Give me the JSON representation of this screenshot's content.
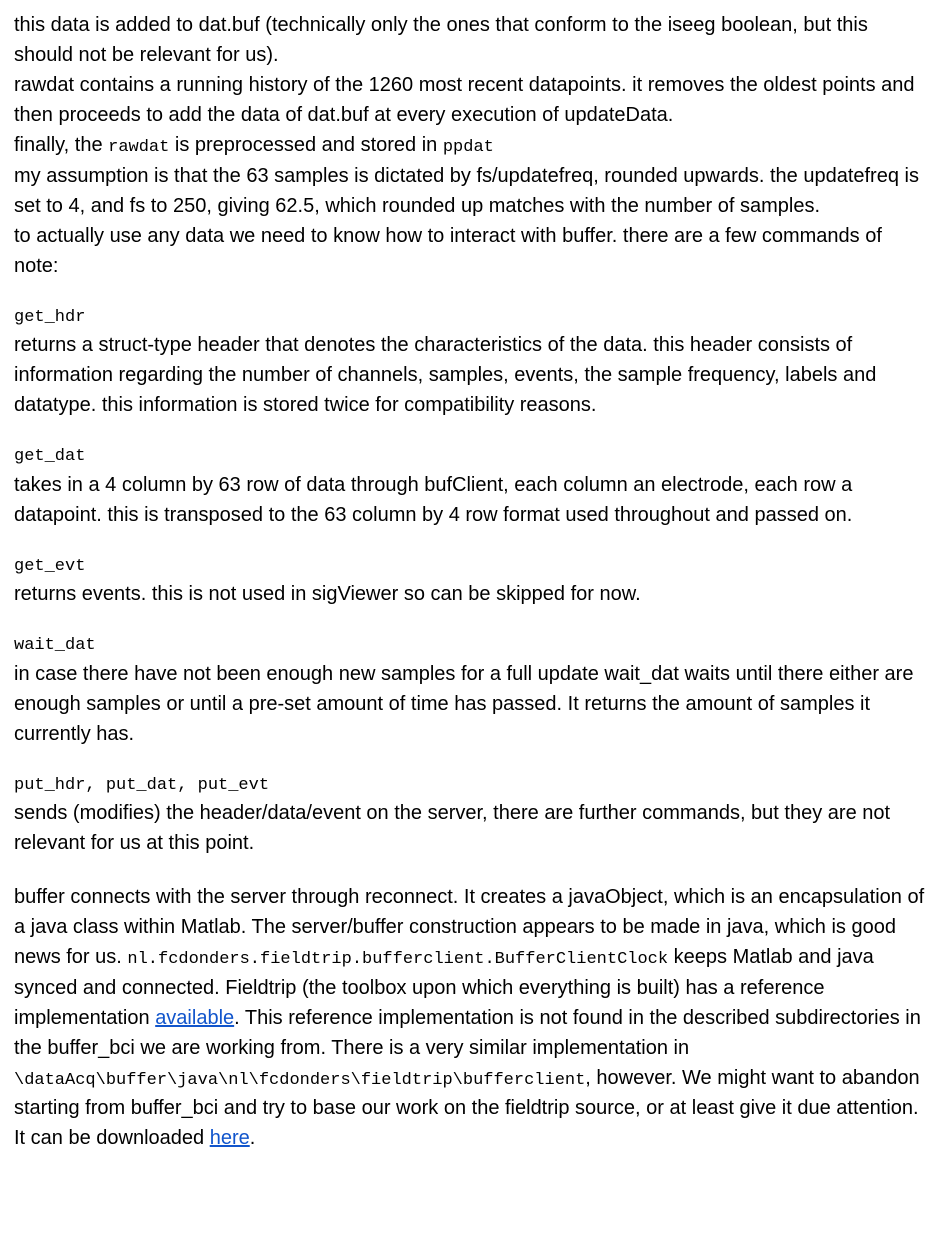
{
  "intro": {
    "p1": "this data is added to dat.buf (technically only the ones that conform to the iseeg boolean, but this should not be relevant for us).",
    "p2": "rawdat contains a running history of the 1260 most recent datapoints. it removes the oldest points and then proceeds to add the data of dat.buf at every execution of updateData.",
    "p3a": "finally, the ",
    "p3_code1": "rawdat",
    "p3b": " is preprocessed and stored in ",
    "p3_code2": "ppdat",
    "p4": "my assumption is that the 63 samples is dictated by fs/updatefreq, rounded upwards. the updatefreq is set to 4, and fs to 250, giving 62.5, which rounded up matches with the number of samples.",
    "p5": "to actually use any data we need to know how to interact with buffer. there are a few commands of note:"
  },
  "commands": {
    "get_hdr": {
      "name": "get_hdr",
      "desc": "returns a struct-type header that denotes the characteristics of the data. this header consists of information regarding the number of channels, samples, events, the sample frequency, labels and datatype. this information is stored twice for compatibility reasons."
    },
    "get_dat": {
      "name": "get_dat",
      "desc": "takes in a 4 column by 63 row of data through bufClient, each column an electrode, each row a datapoint. this is transposed to the 63 column by 4 row format used throughout and passed on."
    },
    "get_evt": {
      "name": "get_evt",
      "desc": "returns events. this is not used in sigViewer so can be skipped for now."
    },
    "wait_dat": {
      "name": "wait_dat",
      "desc": "in case there have not been enough new samples for a full update wait_dat waits until there either are enough samples or until a pre-set amount of time has passed. It returns the amount of samples it currently has."
    },
    "put": {
      "name": "put_hdr, put_dat, put_evt",
      "desc": "sends (modifies) the header/data/event on the server, there are further commands, but they are not relevant for us at this point."
    }
  },
  "footer": {
    "a": "buffer connects with the server through reconnect. It creates a javaObject, which is an encapsulation of a java class within Matlab. The server/buffer construction appears to be made in java, which is good news for us. ",
    "code1": "nl.fcdonders.fieldtrip.bufferclient.BufferClientClock",
    "b": " keeps Matlab and java synced and connected. Fieldtrip (the toolbox upon which everything is built) has a reference implementation ",
    "link1": "available",
    "c": ". This reference implementation is not found in the described subdirectories in the buffer_bci we are working from. There is a very similar implementation in ",
    "code2": "\\dataAcq\\buffer\\java\\nl\\fcdonders\\fieldtrip\\bufferclient",
    "d": ", however. We might want to abandon starting from buffer_bci and try to base our work on the fieldtrip source, or at least give it due attention. It can be downloaded ",
    "link2": "here",
    "e": "."
  }
}
